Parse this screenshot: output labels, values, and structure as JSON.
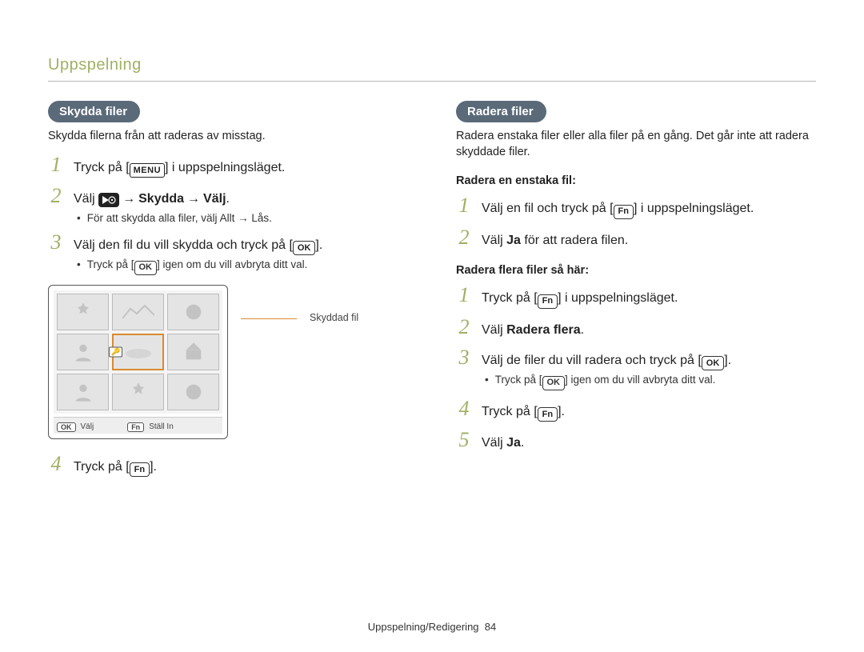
{
  "breadcrumb": "Uppspelning",
  "left": {
    "pill": "Skydda filer",
    "intro": "Skydda filerna från att raderas av misstag.",
    "steps": {
      "s1_a": "Tryck på [",
      "s1_menu": "MENU",
      "s1_b": "] i uppspelningsläget.",
      "s2_a": "Välj ",
      "s2_arrow1": "→",
      "s2_b1": "Skydda",
      "s2_arrow2": "→",
      "s2_b2": "Välj",
      "s2_end": ".",
      "s2_sub_a": "För att skydda alla filer, välj ",
      "s2_sub_b": "Allt → Lås",
      "s2_sub_end": ".",
      "s3_a": "Välj den fil du vill skydda och tryck på [",
      "s3_key": "OK",
      "s3_b": "].",
      "s3_sub_a": "Tryck på [",
      "s3_sub_key": "OK",
      "s3_sub_b": "] igen om du vill avbryta ditt val.",
      "s4_a": "Tryck på [",
      "s4_key": "Fn",
      "s4_b": "]."
    },
    "diagram": {
      "label": "Skyddad fil",
      "bar_ok": "OK",
      "bar_ok_txt": "Välj",
      "bar_fn": "Fn",
      "bar_fn_txt": "Ställ In"
    }
  },
  "right": {
    "pill": "Radera filer",
    "intro": "Radera enstaka filer eller alla filer på en gång. Det går inte att radera skyddade filer.",
    "sub1": "Radera en enstaka fil:",
    "a1_a": "Välj en fil och tryck på [",
    "a1_key": "Fn",
    "a1_b": "] i uppspelningsläget.",
    "a2_a": "Välj ",
    "a2_b": "Ja",
    "a2_c": " för att radera filen.",
    "sub2": "Radera flera filer så här:",
    "b1_a": "Tryck på [",
    "b1_key": "Fn",
    "b1_b": "] i uppspelningsläget.",
    "b2_a": "Välj ",
    "b2_b": "Radera flera",
    "b2_c": ".",
    "b3_a": "Välj de filer du vill radera och tryck på [",
    "b3_key": "OK",
    "b3_b": "].",
    "b3_sub_a": "Tryck på [",
    "b3_sub_key": "OK",
    "b3_sub_b": "] igen om du vill avbryta ditt val.",
    "b4_a": "Tryck på [",
    "b4_key": "Fn",
    "b4_b": "].",
    "b5_a": "Välj ",
    "b5_b": "Ja",
    "b5_c": "."
  },
  "footer_a": "Uppspelning/Redigering",
  "footer_page": "84"
}
